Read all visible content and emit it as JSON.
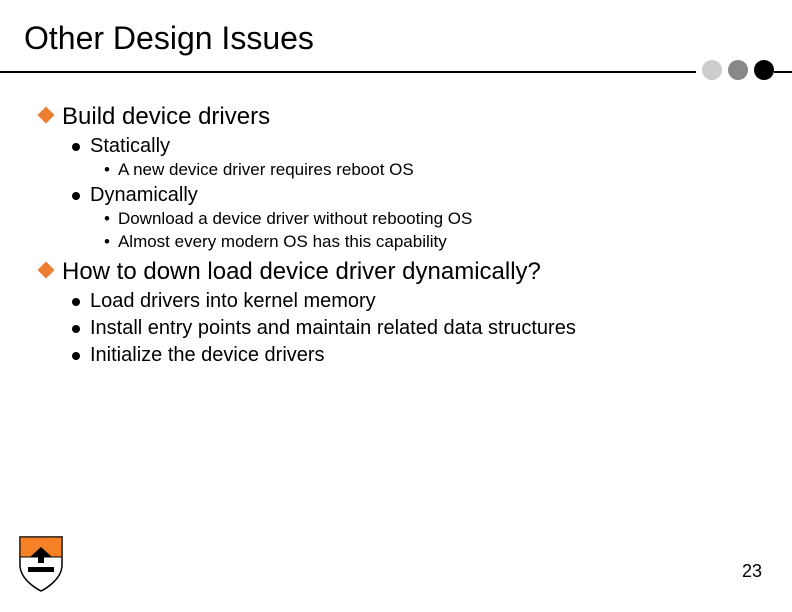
{
  "title": "Other Design Issues",
  "sections": [
    {
      "heading": "Build device drivers",
      "items": [
        {
          "label": "Statically",
          "sub": [
            "A new device driver requires reboot OS"
          ]
        },
        {
          "label": "Dynamically",
          "sub": [
            "Download a device driver without rebooting OS",
            "Almost every modern OS has this capability"
          ]
        }
      ]
    },
    {
      "heading": "How to down load device driver dynamically?",
      "items": [
        {
          "label": "Load drivers into kernel memory",
          "sub": []
        },
        {
          "label": "Install entry points and maintain related data structures",
          "sub": []
        },
        {
          "label": "Initialize the device drivers",
          "sub": []
        }
      ]
    }
  ],
  "page_number": "23"
}
